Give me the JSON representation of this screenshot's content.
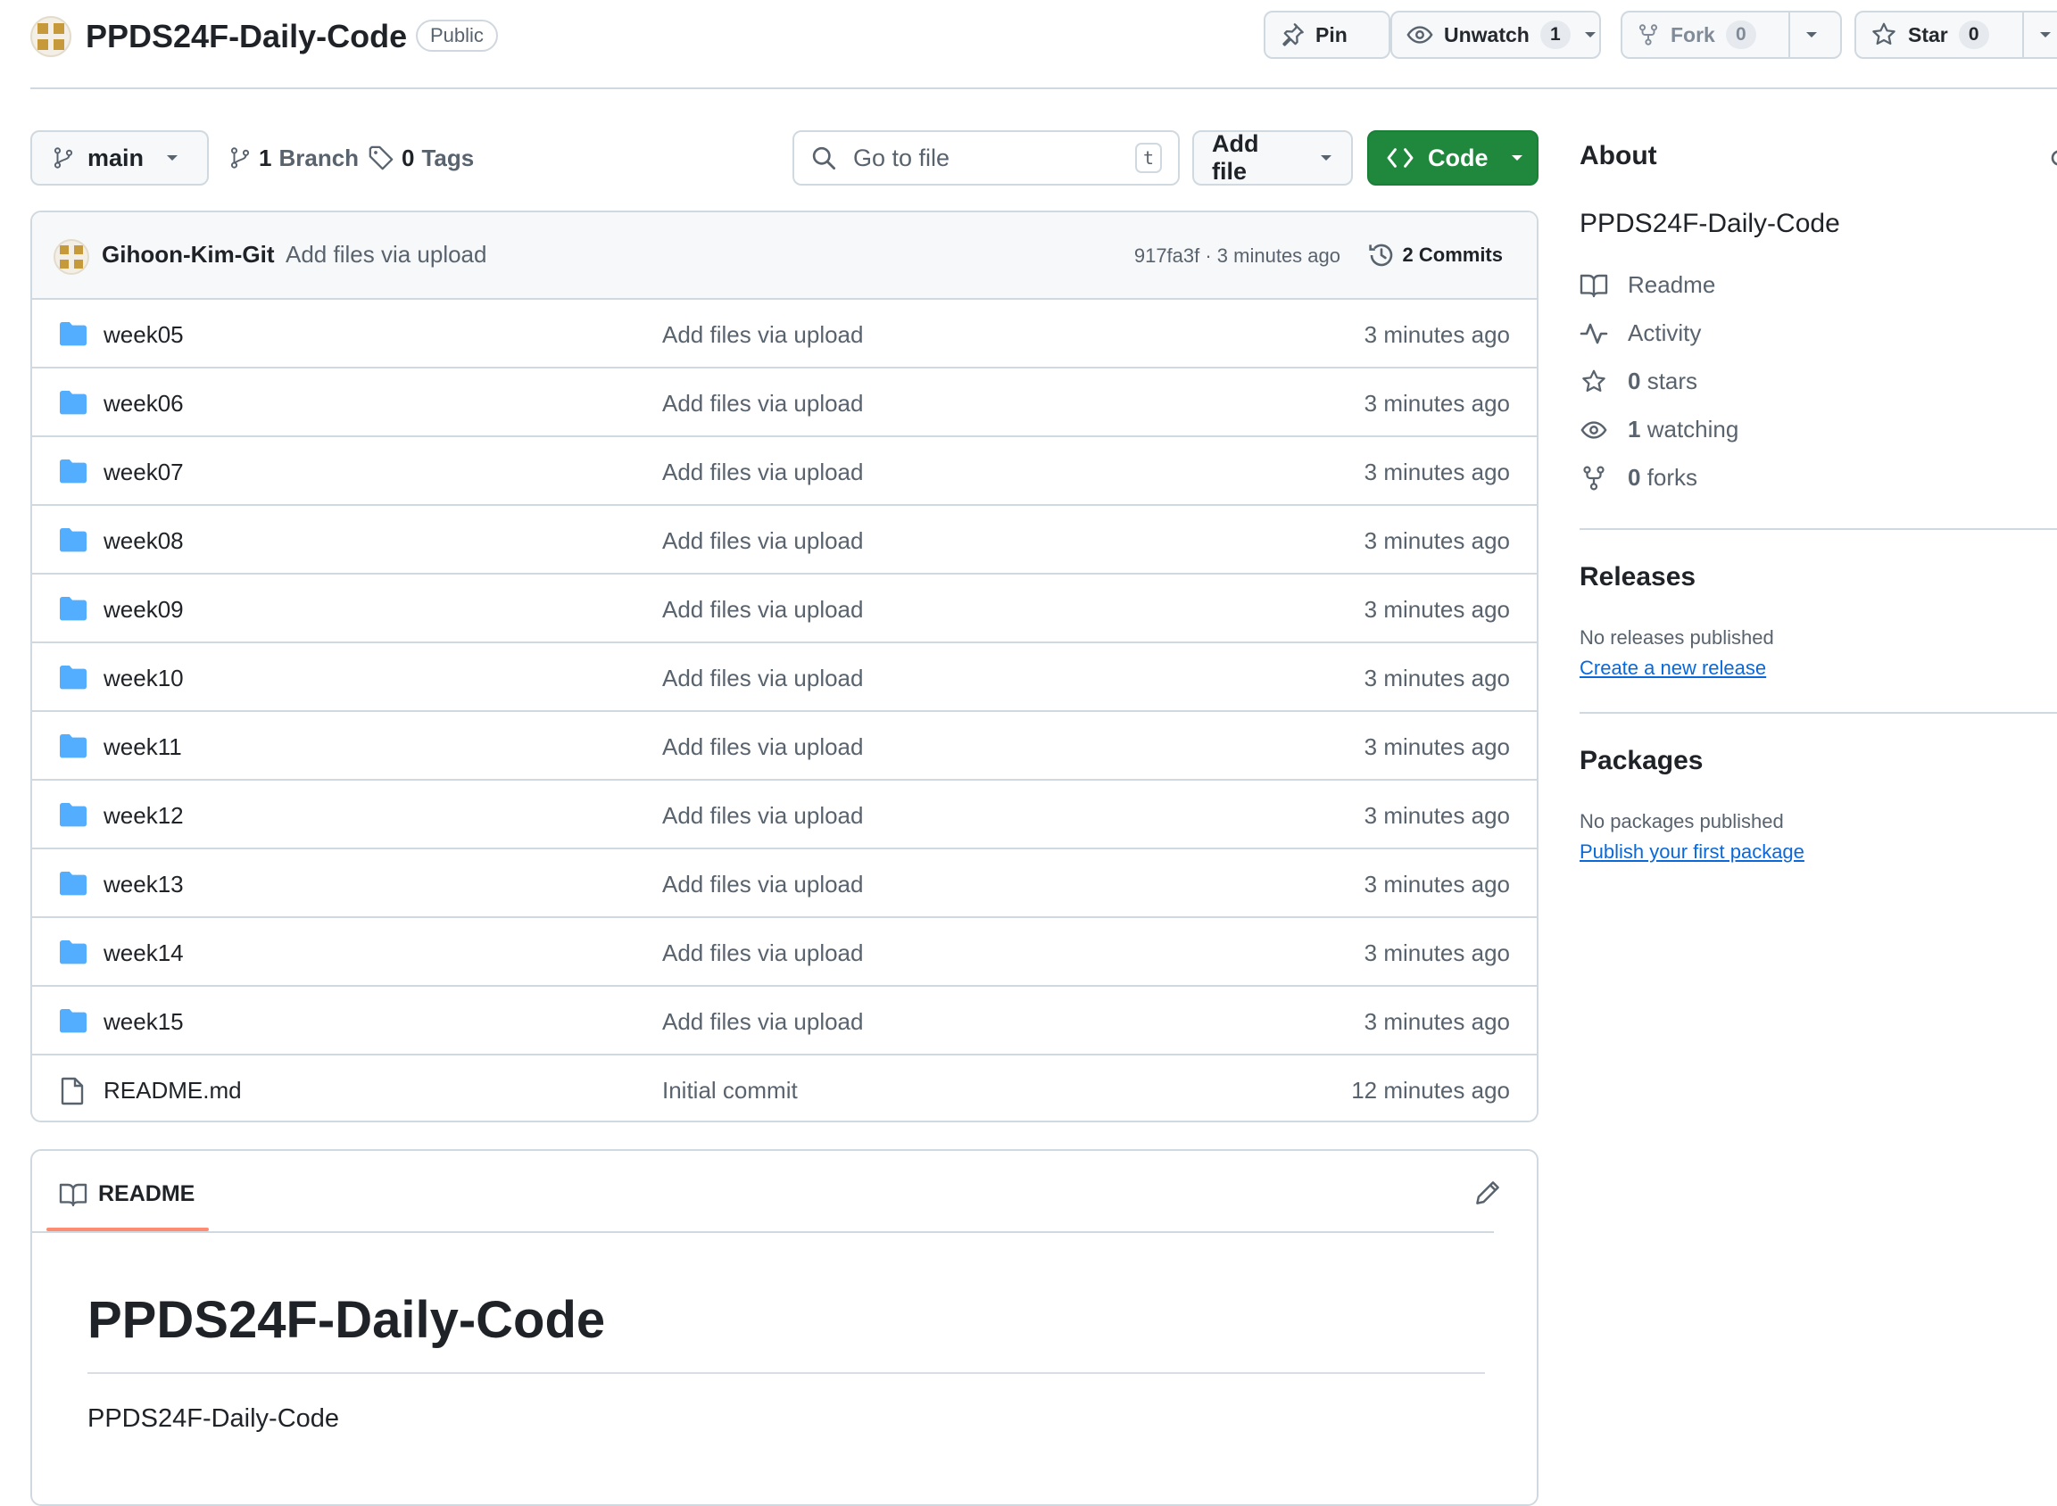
{
  "repo": {
    "name": "PPDS24F-Daily-Code",
    "visibility": "Public"
  },
  "header_actions": {
    "pin_label": "Pin",
    "unwatch_label": "Unwatch",
    "watch_count": "1",
    "fork_label": "Fork",
    "fork_count": "0",
    "star_label": "Star",
    "star_count": "0"
  },
  "toolbar": {
    "branch_selected": "main",
    "branches_count": "1",
    "branches_label": "Branch",
    "tags_count": "0",
    "tags_label": "Tags",
    "search_placeholder": "Go to file",
    "search_shortcut": "t",
    "add_file_label": "Add file",
    "code_label": "Code"
  },
  "latest_commit": {
    "author": "Gihoon-Kim-Git",
    "message": "Add files via upload",
    "meta": "917fa3f · 3 minutes ago",
    "commits_label": "2 Commits"
  },
  "files": [
    {
      "name": "week05",
      "type": "folder",
      "message": "Add files via upload",
      "age": "3 minutes ago"
    },
    {
      "name": "week06",
      "type": "folder",
      "message": "Add files via upload",
      "age": "3 minutes ago"
    },
    {
      "name": "week07",
      "type": "folder",
      "message": "Add files via upload",
      "age": "3 minutes ago"
    },
    {
      "name": "week08",
      "type": "folder",
      "message": "Add files via upload",
      "age": "3 minutes ago"
    },
    {
      "name": "week09",
      "type": "folder",
      "message": "Add files via upload",
      "age": "3 minutes ago"
    },
    {
      "name": "week10",
      "type": "folder",
      "message": "Add files via upload",
      "age": "3 minutes ago"
    },
    {
      "name": "week11",
      "type": "folder",
      "message": "Add files via upload",
      "age": "3 minutes ago"
    },
    {
      "name": "week12",
      "type": "folder",
      "message": "Add files via upload",
      "age": "3 minutes ago"
    },
    {
      "name": "week13",
      "type": "folder",
      "message": "Add files via upload",
      "age": "3 minutes ago"
    },
    {
      "name": "week14",
      "type": "folder",
      "message": "Add files via upload",
      "age": "3 minutes ago"
    },
    {
      "name": "week15",
      "type": "folder",
      "message": "Add files via upload",
      "age": "3 minutes ago"
    },
    {
      "name": "README.md",
      "type": "file",
      "message": "Initial commit",
      "age": "12 minutes ago"
    }
  ],
  "readme": {
    "tab_label": "README",
    "title": "PPDS24F-Daily-Code",
    "body": "PPDS24F-Daily-Code"
  },
  "about": {
    "heading": "About",
    "description": "PPDS24F-Daily-Code",
    "readme_label": "Readme",
    "activity_label": "Activity",
    "stars_count": "0",
    "stars_label": "stars",
    "watching_count": "1",
    "watching_label": "watching",
    "forks_count": "0",
    "forks_label": "forks"
  },
  "releases": {
    "heading": "Releases",
    "note": "No releases published",
    "link": "Create a new release"
  },
  "packages": {
    "heading": "Packages",
    "note": "No packages published",
    "link": "Publish your first package"
  },
  "colors": {
    "accent_green": "#1f883d",
    "link_blue": "#0969da",
    "folder_blue": "#54aeff",
    "tab_underline": "#fd8c73"
  }
}
